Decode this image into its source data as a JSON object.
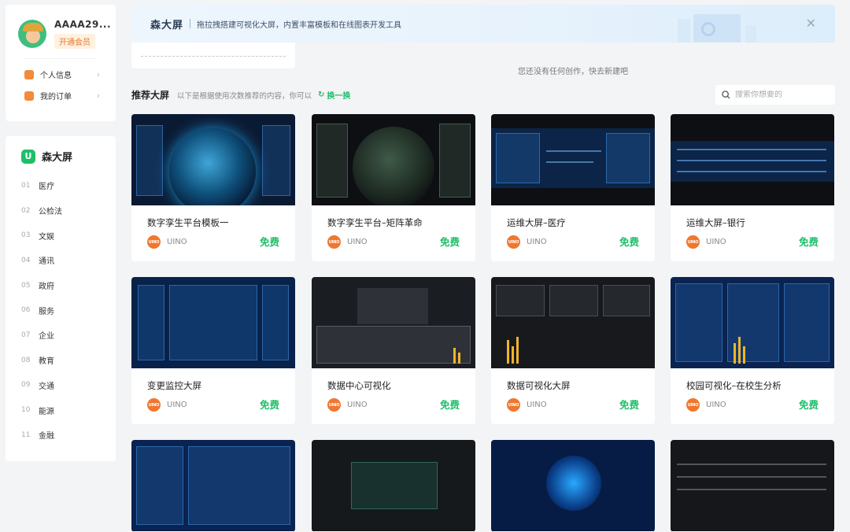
{
  "user": {
    "name": "AAAA29...",
    "vip_label": "开通会员",
    "menu": [
      {
        "label": "个人信息",
        "icon": "user-info-icon"
      },
      {
        "label": "我的订单",
        "icon": "order-icon"
      }
    ]
  },
  "brand": {
    "logo_char": "U",
    "name": "森大屏"
  },
  "categories": [
    {
      "num": "01",
      "label": "医疗"
    },
    {
      "num": "02",
      "label": "公检法"
    },
    {
      "num": "03",
      "label": "文娱"
    },
    {
      "num": "04",
      "label": "通讯"
    },
    {
      "num": "05",
      "label": "政府"
    },
    {
      "num": "06",
      "label": "服务"
    },
    {
      "num": "07",
      "label": "企业"
    },
    {
      "num": "08",
      "label": "教育"
    },
    {
      "num": "09",
      "label": "交通"
    },
    {
      "num": "10",
      "label": "能源"
    },
    {
      "num": "11",
      "label": "金融"
    }
  ],
  "banner": {
    "title": "森大屏",
    "desc": "拖拉拽搭建可视化大屏，内置丰富模板和在线图表开发工具",
    "close": "✕"
  },
  "empty_hint": "您还没有任何创作，快去新建吧",
  "recommend": {
    "title": "推荐大屏",
    "desc": "以下是根据使用次数推荐的内容，你可以",
    "refresh_label": "换一换",
    "refresh_icon": "↻"
  },
  "search": {
    "placeholder": "搜索你想要的",
    "icon": "search-icon"
  },
  "cards": [
    {
      "title": "数字孪生平台模板一",
      "author": "UINO",
      "price": "免费",
      "logo": "UINO"
    },
    {
      "title": "数字孪生平台–矩阵革命",
      "author": "UINO",
      "price": "免费",
      "logo": "UINO"
    },
    {
      "title": "运维大屏–医疗",
      "author": "UINO",
      "price": "免费",
      "logo": "UINO"
    },
    {
      "title": "运维大屏–银行",
      "author": "UINO",
      "price": "免费",
      "logo": "UINO"
    },
    {
      "title": "变更监控大屏",
      "author": "UINO",
      "price": "免费",
      "logo": "UINO"
    },
    {
      "title": "数据中心可视化",
      "author": "UINO",
      "price": "免费",
      "logo": "UINO"
    },
    {
      "title": "数据可视化大屏",
      "author": "UINO",
      "price": "免费",
      "logo": "UINO"
    },
    {
      "title": "校园可视化–在校生分析",
      "author": "UINO",
      "price": "免费",
      "logo": "UINO"
    }
  ]
}
